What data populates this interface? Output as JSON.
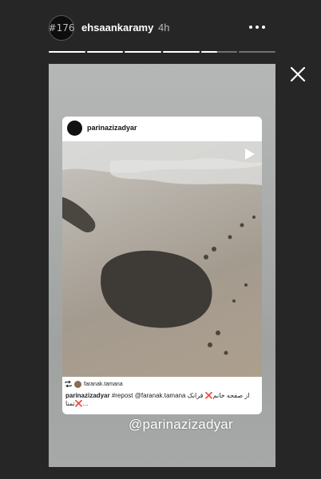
{
  "header": {
    "avatar_text": "#176",
    "username": "ehsaankaramy",
    "time": "4h"
  },
  "progress": {
    "segment_count": 6,
    "segments_done": 4,
    "current_fraction": 0.45
  },
  "story": {
    "card": {
      "username": "parinazizadyar",
      "tagged_username": "faranak.tamana",
      "caption_user": "parinazizadyar",
      "caption_text": "#repost @faranak.tamana از صفحه خانم❌ فرانک تمنا❌..."
    },
    "watermark": "@parinazizadyar"
  },
  "icons": {
    "more": "more-horizontal-icon",
    "close": "close-icon",
    "play": "play-icon",
    "repost": "repost-icon"
  }
}
